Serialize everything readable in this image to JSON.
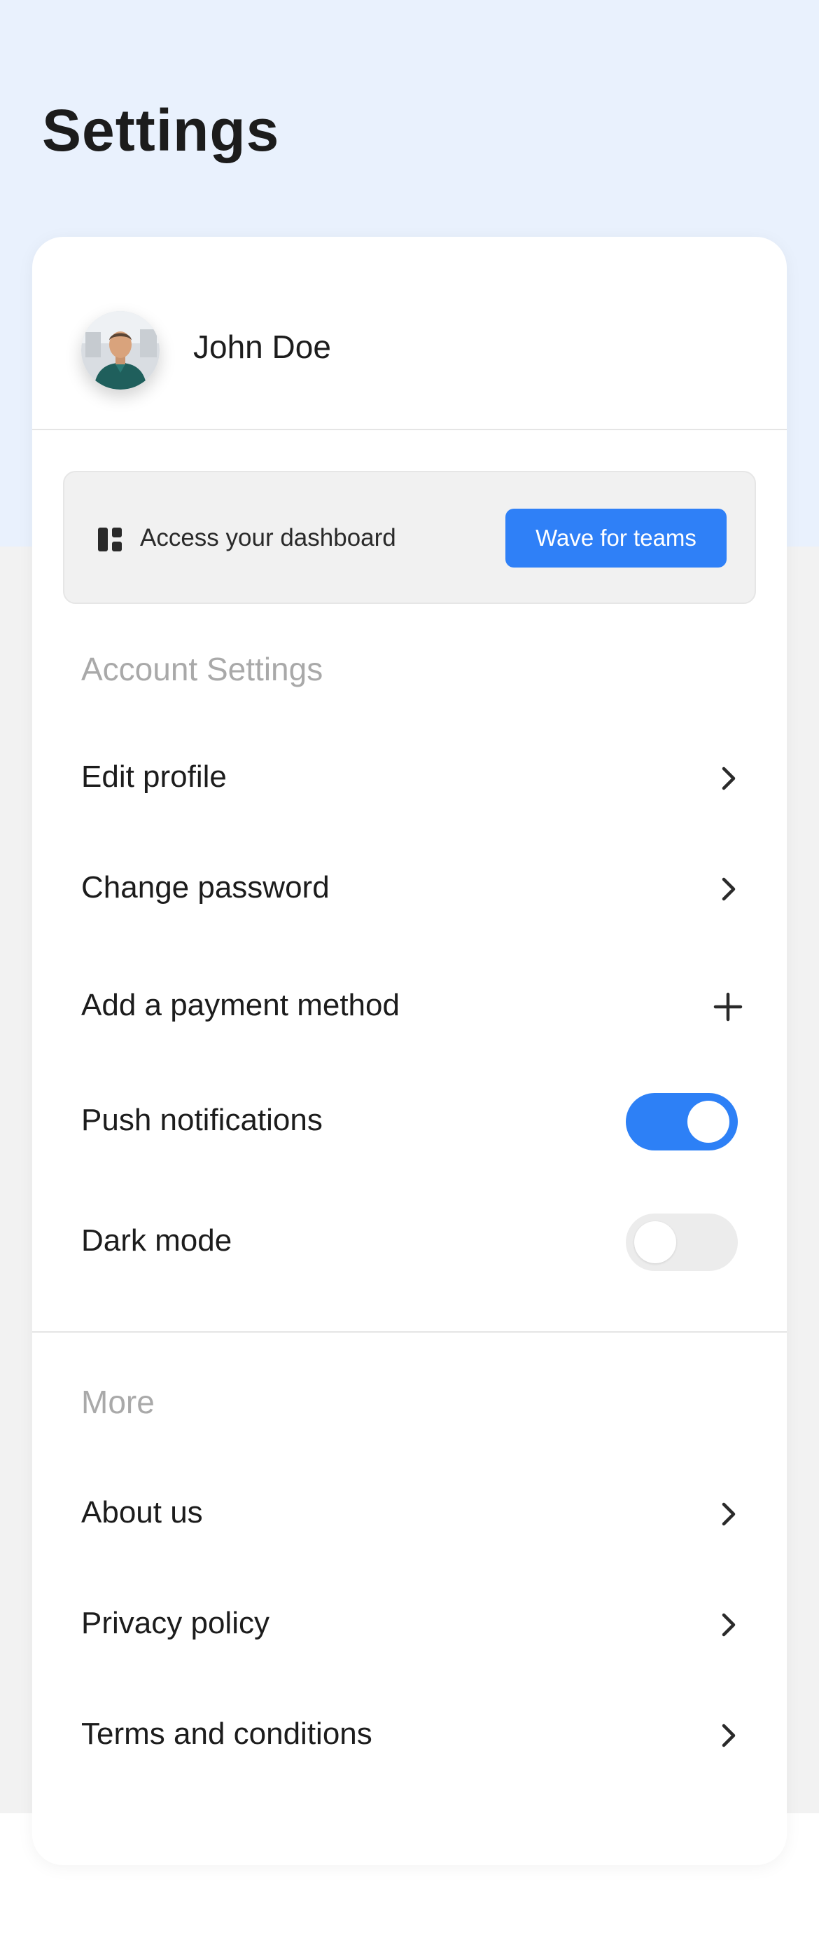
{
  "header": {
    "title": "Settings"
  },
  "profile": {
    "name": "John Doe",
    "avatar_icon": "user-avatar"
  },
  "dashboard_banner": {
    "icon": "dashboard-icon",
    "text": "Access your dashboard",
    "button_label": "Wave for teams"
  },
  "account_settings": {
    "title": "Account Settings",
    "items": [
      {
        "label": "Edit profile",
        "action": "chevron-right-icon"
      },
      {
        "label": "Change password",
        "action": "chevron-right-icon"
      },
      {
        "label": "Add a payment method",
        "action": "plus-icon"
      },
      {
        "label": "Push notifications",
        "action": "toggle",
        "enabled": true
      },
      {
        "label": "Dark mode",
        "action": "toggle",
        "enabled": false
      }
    ]
  },
  "more": {
    "title": "More",
    "items": [
      {
        "label": "About us",
        "action": "chevron-right-icon"
      },
      {
        "label": "Privacy policy",
        "action": "chevron-right-icon"
      },
      {
        "label": "Terms and conditions",
        "action": "chevron-right-icon"
      }
    ]
  },
  "colors": {
    "accent": "#2f80f7",
    "header_bg": "#e9f1fd",
    "page_bg": "#f2f2f2",
    "section_label": "#a9a9a9"
  }
}
